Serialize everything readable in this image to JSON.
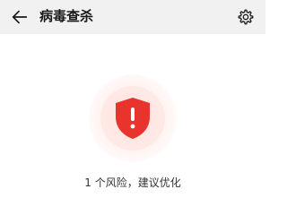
{
  "header": {
    "title": "病毒查杀",
    "back_icon": "arrow-left-icon",
    "settings_icon": "gear-icon"
  },
  "status": {
    "icon": "shield-alert-icon",
    "message": "1 个风险，建议优化"
  },
  "colors": {
    "danger": "#e8342c",
    "topbar_bg": "#f1f1f1"
  }
}
